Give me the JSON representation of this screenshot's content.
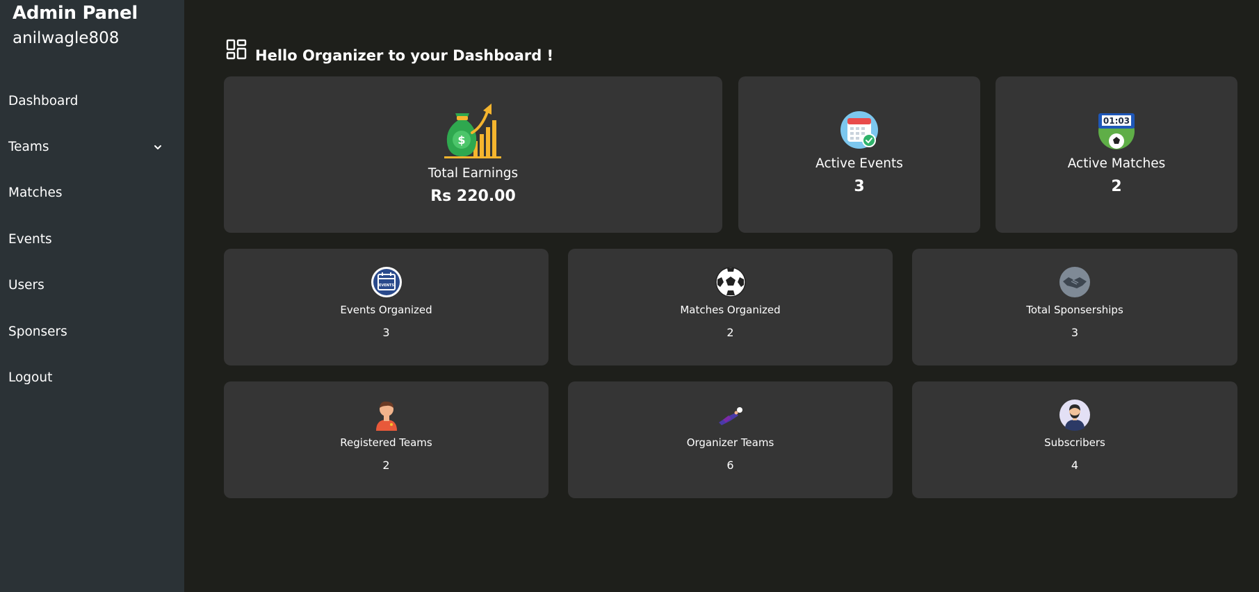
{
  "sidebar": {
    "title": "Admin Panel",
    "username": "anilwagle808",
    "items": [
      {
        "label": "Dashboard"
      },
      {
        "label": "Teams"
      },
      {
        "label": "Matches"
      },
      {
        "label": "Events"
      },
      {
        "label": "Users"
      },
      {
        "label": "Sponsers"
      },
      {
        "label": "Logout"
      }
    ]
  },
  "header": {
    "title": "Hello Organizer to your Dashboard !",
    "icon": "dashboard-grid-icon"
  },
  "top_cards": [
    {
      "label": "Total Earnings",
      "value": "Rs 220.00",
      "icon": "money-bag-growth-icon"
    },
    {
      "label": "Active Events",
      "value": "3",
      "icon": "calendar-check-icon"
    },
    {
      "label": "Active Matches",
      "value": "2",
      "icon": "scoreboard-ball-icon"
    }
  ],
  "scoreboard_time": "01:03",
  "grid_cards": [
    {
      "label": "Events Organized",
      "value": "3",
      "icon": "events-calendar-icon"
    },
    {
      "label": "Matches Organized",
      "value": "2",
      "icon": "soccer-ball-icon"
    },
    {
      "label": "Total Sponserships",
      "value": "3",
      "icon": "handshake-icon"
    },
    {
      "label": "Registered Teams",
      "value": "2",
      "icon": "player-icon"
    },
    {
      "label": "Organizer Teams",
      "value": "6",
      "icon": "goalkeeper-icon"
    },
    {
      "label": "Subscribers",
      "value": "4",
      "icon": "user-avatar-icon"
    }
  ],
  "events_badge": "EVENTS"
}
